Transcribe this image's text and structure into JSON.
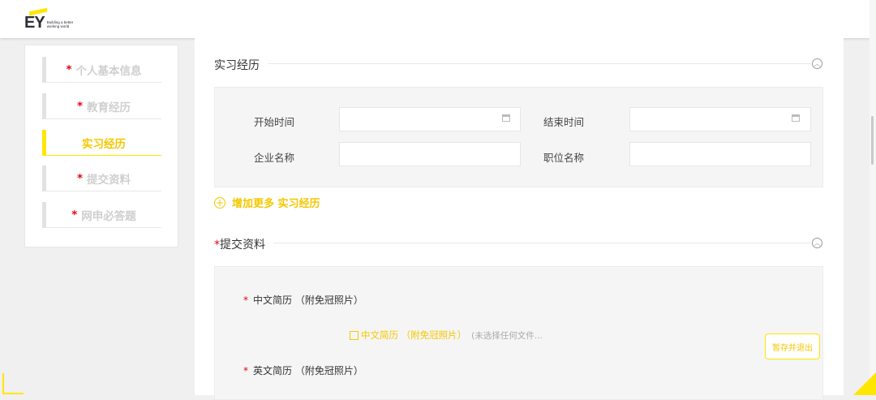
{
  "brand": {
    "logo_text": "EY",
    "tagline": "Building a better\nworking world",
    "accent": "#ffe600",
    "required_color": "#e60012"
  },
  "sidebar": {
    "items": [
      {
        "label": "个人基本信息",
        "required": true,
        "active": false
      },
      {
        "label": "教育经历",
        "required": true,
        "active": false
      },
      {
        "label": "实习经历",
        "required": false,
        "active": true
      },
      {
        "label": "提交资料",
        "required": true,
        "active": false
      },
      {
        "label": "网申必答题",
        "required": true,
        "active": false
      }
    ]
  },
  "internship": {
    "title": "实习经历",
    "collapse_icon": "chevron-up-icon",
    "fields": {
      "start_label": "开始时间",
      "start_value": "",
      "end_label": "结束时间",
      "end_value": "",
      "company_label": "企业名称",
      "company_value": "",
      "position_label": "职位名称",
      "position_value": ""
    },
    "add_more_label": "增加更多 实习经历"
  },
  "submit": {
    "title": "提交资料",
    "required_mark": "*",
    "cn_resume_label": "中文简历 （附免冠照片）",
    "file_link_label": "中文简历 （附免冠照片）",
    "no_file_text": "(未选择任何文件...",
    "en_resume_label": "英文简历 （附免冠照片）",
    "save_exit_label": "暂存并退出"
  }
}
